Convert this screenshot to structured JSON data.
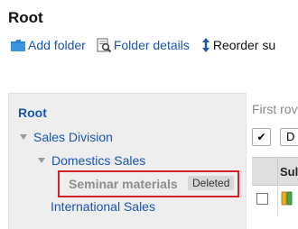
{
  "page": {
    "title": "Root"
  },
  "toolbar": {
    "add_folder": "Add folder",
    "folder_details": "Folder details",
    "reorder": "Reorder su"
  },
  "tree": {
    "root": "Root",
    "sales_division": "Sales Division",
    "domestic_sales": "Domestics Sales",
    "seminar_materials": "Seminar materials",
    "deleted_badge": "Deleted",
    "international_sales": "International Sales"
  },
  "main": {
    "first_row_text": "First rov",
    "check_symbol": "✔",
    "select_label": "D",
    "column_header": "Sul"
  },
  "colors": {
    "link": "#1a56b4",
    "highlight_border": "#d4202a",
    "panel_bg": "#eeeeee"
  }
}
